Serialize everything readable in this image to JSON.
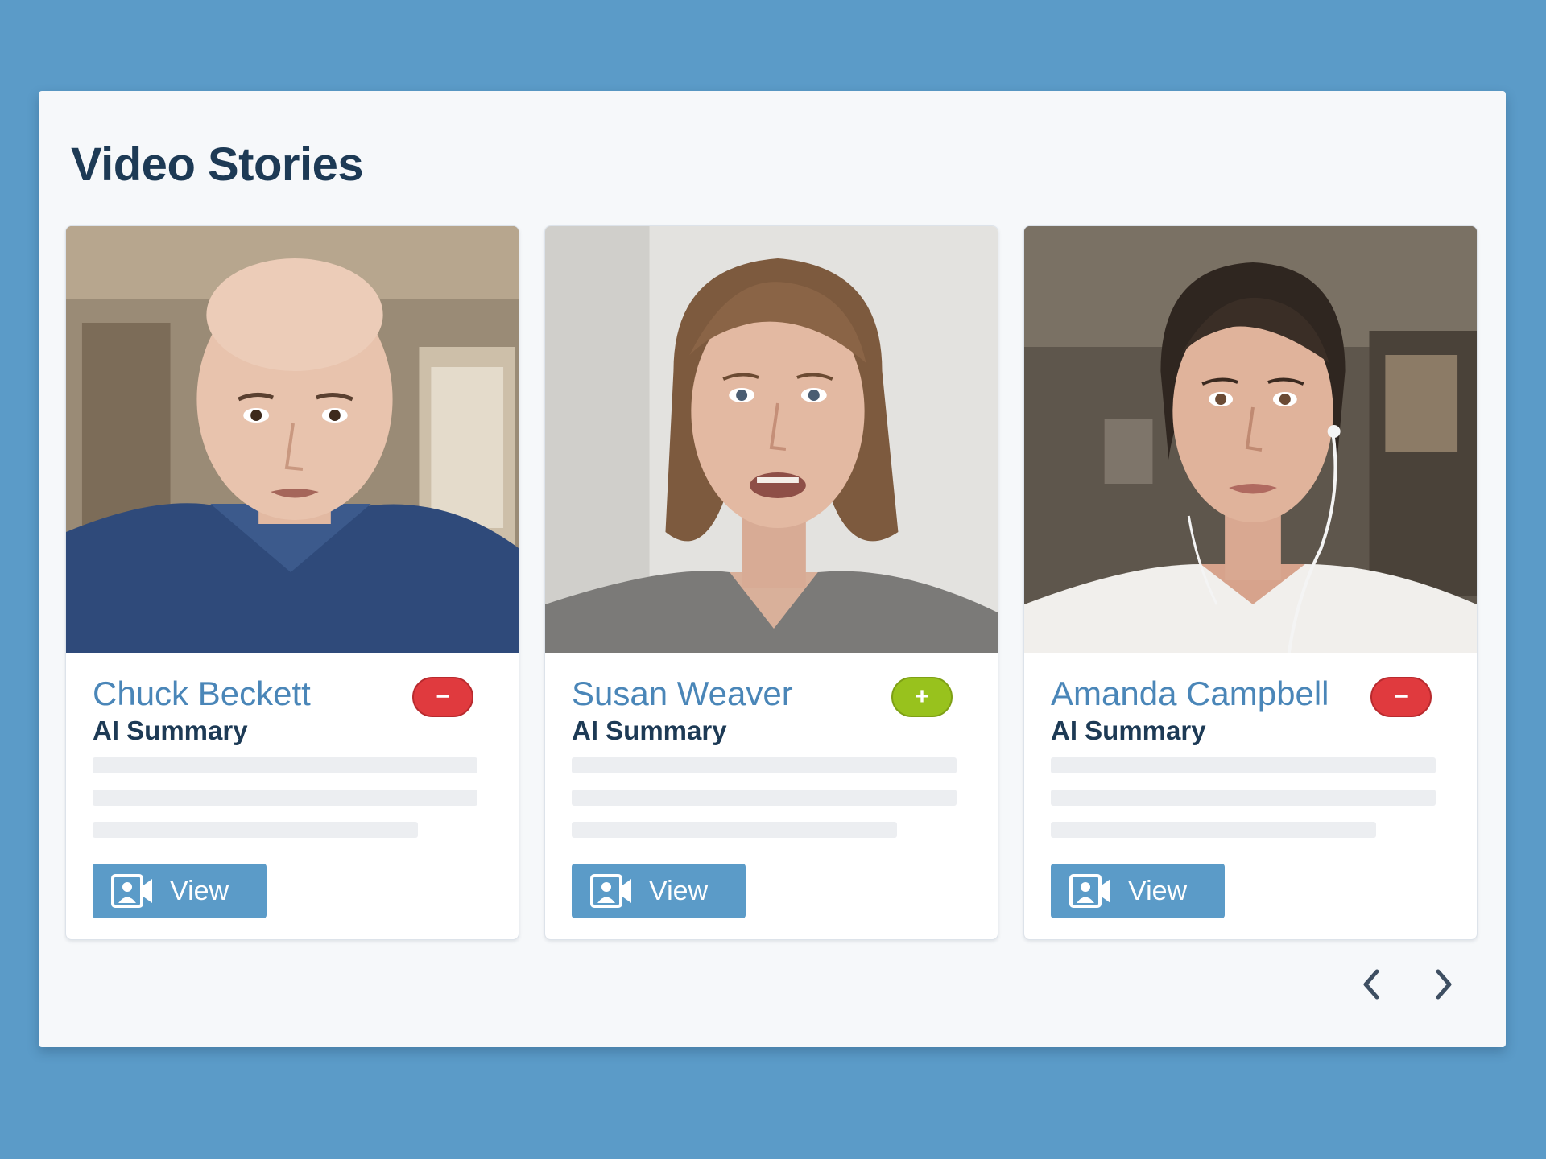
{
  "panel": {
    "title": "Video Stories"
  },
  "cards": [
    {
      "name": "Chuck Beckett",
      "subtitle": "AI Summary",
      "badge": {
        "symbol": "−",
        "kind": "minus",
        "color": "#e03a3e"
      },
      "view_label": "View",
      "video_icon": "video-camera-user-icon"
    },
    {
      "name": "Susan Weaver",
      "subtitle": "AI Summary",
      "badge": {
        "symbol": "+",
        "kind": "plus",
        "color": "#98c21d"
      },
      "view_label": "View",
      "video_icon": "video-camera-user-icon"
    },
    {
      "name": "Amanda Campbell",
      "subtitle": "AI Summary",
      "badge": {
        "symbol": "−",
        "kind": "minus",
        "color": "#e03a3e"
      },
      "view_label": "View",
      "video_icon": "video-camera-user-icon"
    }
  ],
  "pagination": {
    "prev_icon": "chevron-left-icon",
    "next_icon": "chevron-right-icon"
  },
  "colors": {
    "accent": "#5b9bc8",
    "name_text": "#4a86b8",
    "heading_text": "#1d3a55"
  }
}
